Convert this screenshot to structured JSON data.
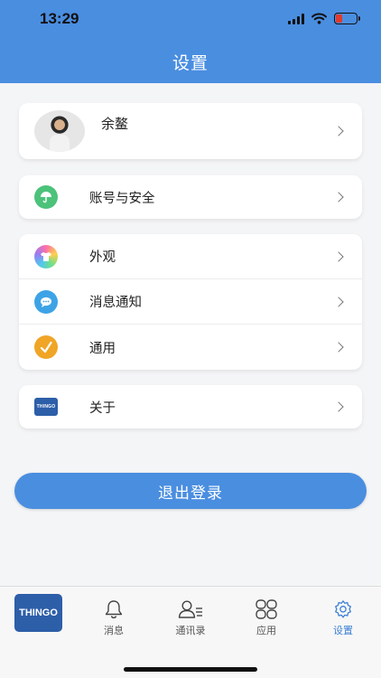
{
  "status": {
    "time": "13:29",
    "battery_level": 0.3
  },
  "header": {
    "title": "设置"
  },
  "profile": {
    "name": "余鳌"
  },
  "menu": {
    "account_security": {
      "label": "账号与安全",
      "icon": "umbrella-icon",
      "color": "#4cc27a"
    },
    "group": [
      {
        "label": "外观",
        "icon": "tshirt-icon"
      },
      {
        "label": "消息通知",
        "icon": "chat-icon",
        "color": "#3ea3e6"
      },
      {
        "label": "通用",
        "icon": "check-icon",
        "color": "#f0a526"
      }
    ],
    "about": {
      "label": "关于",
      "icon": "thingo-logo"
    }
  },
  "logout_label": "退出登录",
  "brand": {
    "logo_text": "THINGO",
    "color": "#2d5ea8"
  },
  "tabs": [
    {
      "label": "消息",
      "icon": "bell-icon"
    },
    {
      "label": "通讯录",
      "icon": "contacts-icon"
    },
    {
      "label": "应用",
      "icon": "apps-icon"
    },
    {
      "label": "设置",
      "icon": "gear-icon",
      "active": true
    }
  ],
  "colors": {
    "accent": "#4a8ee0",
    "active_tab": "#3b7fd4"
  }
}
